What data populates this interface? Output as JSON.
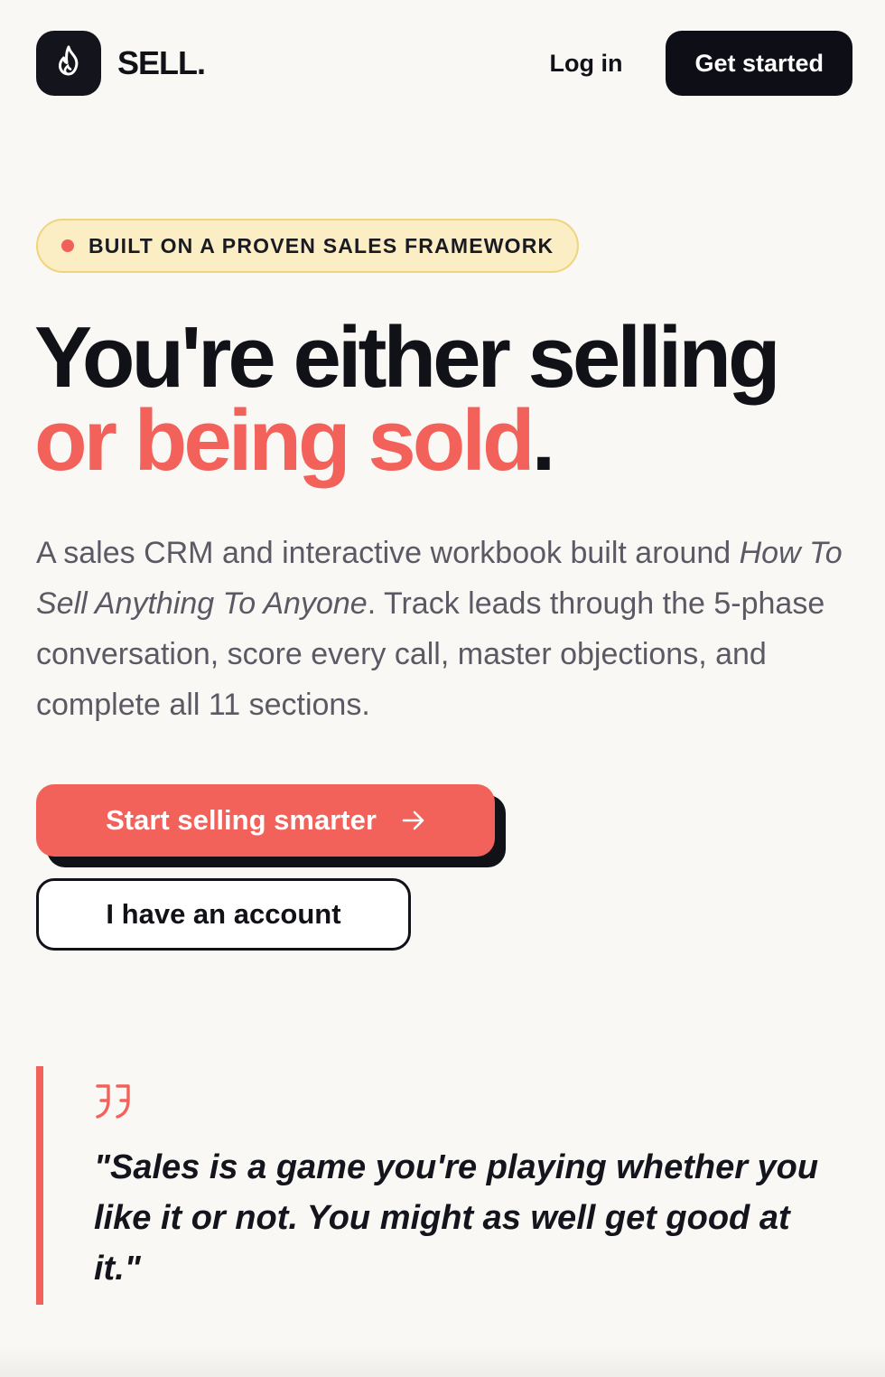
{
  "header": {
    "brand_name": "SELL.",
    "login_label": "Log in",
    "get_started_label": "Get started"
  },
  "icons": {
    "logo": "flame-icon",
    "cta_arrow": "arrow-right-icon",
    "quote": "quote-mark-icon"
  },
  "hero": {
    "badge_text": "BUILT ON A PROVEN SALES FRAMEWORK",
    "headline_line1": "You're either selling",
    "headline_accent": "or being sold",
    "headline_period": ".",
    "description_intro": "A sales CRM and interactive workbook built around ",
    "description_book": "How To Sell Anything To Anyone",
    "description_rest": ". Track leads through the 5-phase conversation, score every call, master objections, and complete all 11 sections.",
    "primary_cta": "Start selling smarter",
    "secondary_cta": "I have an account"
  },
  "quote": {
    "text": "\"Sales is a game you're playing whether you like it or not. You might as well get good at it.\""
  },
  "colors": {
    "background": "#f9f8f5",
    "ink": "#111118",
    "accent": "#f2625a",
    "badge_bg": "#fbeec4",
    "badge_border": "#f0d47c",
    "muted_text": "#5b5a64"
  }
}
